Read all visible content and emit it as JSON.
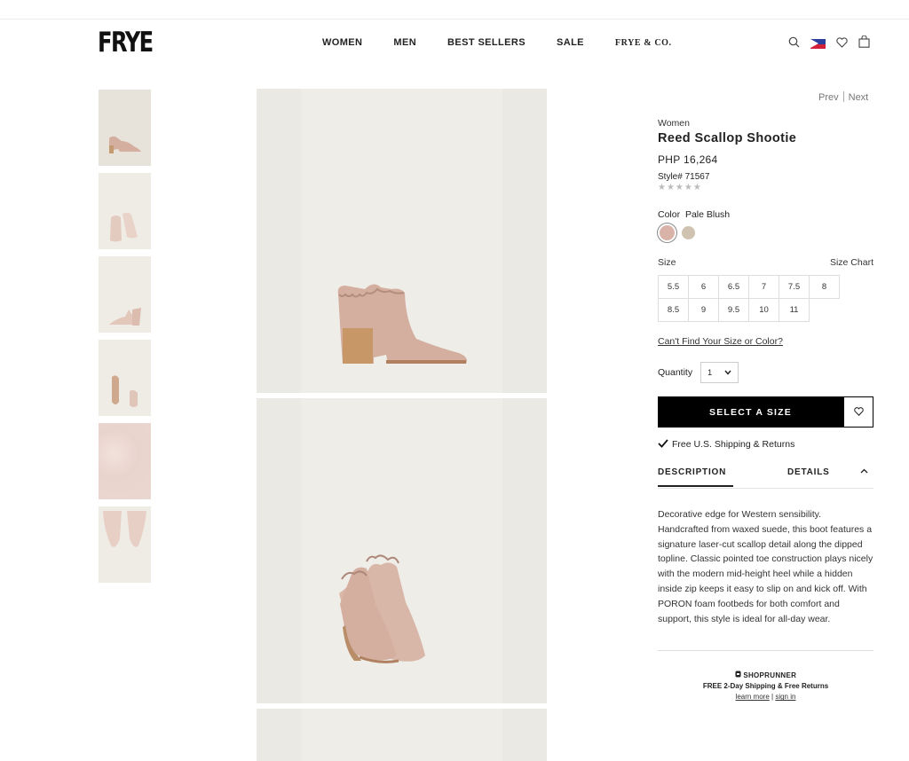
{
  "header": {
    "logo": "FRYE",
    "nav": [
      "WOMEN",
      "MEN",
      "BEST SELLERS",
      "SALE",
      "FRYE & CO."
    ],
    "icons": [
      "search-icon",
      "philippines-flag-icon",
      "heart-icon",
      "bag-icon"
    ]
  },
  "pager": {
    "prev": "Prev",
    "next": "Next"
  },
  "product": {
    "breadcrumb": "Women",
    "name": "Reed Scallop Shootie",
    "price": "PHP 16,264",
    "style": "Style# 71567",
    "rating_stars": "★★★★★",
    "rating": 0,
    "color_label": "Color",
    "color_value": "Pale Blush",
    "swatches": [
      "#d9b2a8",
      "#cfc2b0"
    ],
    "size_label": "Size",
    "size_chart": "Size Chart",
    "sizes": [
      "5.5",
      "6",
      "6.5",
      "7",
      "7.5",
      "8",
      "8.5",
      "9",
      "9.5",
      "10",
      "11"
    ],
    "cant_find": "Can't Find Your Size or Color?",
    "quantity_label": "Quantity",
    "quantity_value": "1",
    "cta": "SELECT A SIZE",
    "shipping": "Free U.S. Shipping & Returns",
    "tabs": {
      "description": "DESCRIPTION",
      "details": "DETAILS"
    },
    "description": "Decorative edge for Western sensibility. Handcrafted from waxed suede, this boot features a signature laser-cut scallop detail along the dipped topline. Classic pointed toe construction plays nicely with the modern mid-height heel while a hidden inside zip keeps it easy to slip on and kick off. With PORON foam footbeds for both comfort and support, this style is ideal for all-day wear."
  },
  "shoprunner": {
    "brand": "SHOPRUNNER",
    "tagline": "FREE 2-Day Shipping & Free Returns",
    "learn_more": "learn more",
    "sign_in": "sign in"
  },
  "colors": {
    "shoe": "#d6b8aa",
    "image_bg": "#ebe9e3",
    "cta_bg": "#000000"
  }
}
